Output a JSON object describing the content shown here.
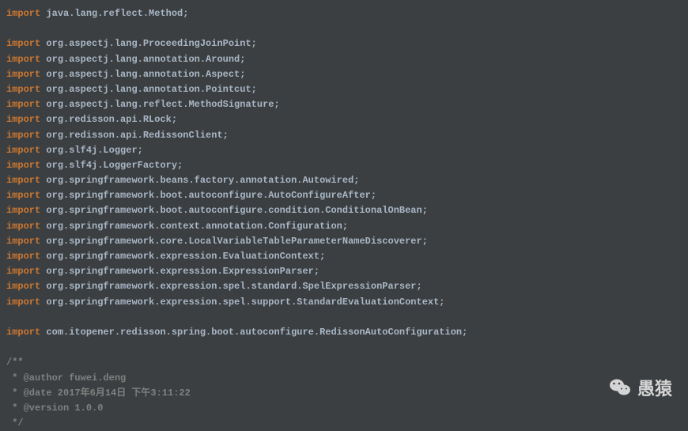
{
  "imports": [
    {
      "keyword": "import",
      "path": "java.lang.reflect.Method;"
    },
    {
      "blank": true
    },
    {
      "keyword": "import",
      "path": "org.aspectj.lang.ProceedingJoinPoint;"
    },
    {
      "keyword": "import",
      "path": "org.aspectj.lang.annotation.Around;"
    },
    {
      "keyword": "import",
      "path": "org.aspectj.lang.annotation.Aspect;"
    },
    {
      "keyword": "import",
      "path": "org.aspectj.lang.annotation.Pointcut;"
    },
    {
      "keyword": "import",
      "path": "org.aspectj.lang.reflect.MethodSignature;"
    },
    {
      "keyword": "import",
      "path": "org.redisson.api.RLock;"
    },
    {
      "keyword": "import",
      "path": "org.redisson.api.RedissonClient;"
    },
    {
      "keyword": "import",
      "path": "org.slf4j.Logger;"
    },
    {
      "keyword": "import",
      "path": "org.slf4j.LoggerFactory;"
    },
    {
      "keyword": "import",
      "path": "org.springframework.beans.factory.annotation.Autowired;"
    },
    {
      "keyword": "import",
      "path": "org.springframework.boot.autoconfigure.AutoConfigureAfter;"
    },
    {
      "keyword": "import",
      "path": "org.springframework.boot.autoconfigure.condition.ConditionalOnBean;"
    },
    {
      "keyword": "import",
      "path": "org.springframework.context.annotation.Configuration;"
    },
    {
      "keyword": "import",
      "path": "org.springframework.core.LocalVariableTableParameterNameDiscoverer;"
    },
    {
      "keyword": "import",
      "path": "org.springframework.expression.EvaluationContext;"
    },
    {
      "keyword": "import",
      "path": "org.springframework.expression.ExpressionParser;"
    },
    {
      "keyword": "import",
      "path": "org.springframework.expression.spel.standard.SpelExpressionParser;"
    },
    {
      "keyword": "import",
      "path": "org.springframework.expression.spel.support.StandardEvaluationContext;"
    },
    {
      "blank": true
    },
    {
      "keyword": "import",
      "path": "com.itopener.redisson.spring.boot.autoconfigure.RedissonAutoConfiguration;"
    },
    {
      "blank": true
    }
  ],
  "comments": [
    "/**",
    " * @author fuwei.deng",
    " * @date 2017年6月14日 下午3:11:22",
    " * @version 1.0.0",
    " */"
  ],
  "watermark": {
    "text": "愚猿"
  }
}
